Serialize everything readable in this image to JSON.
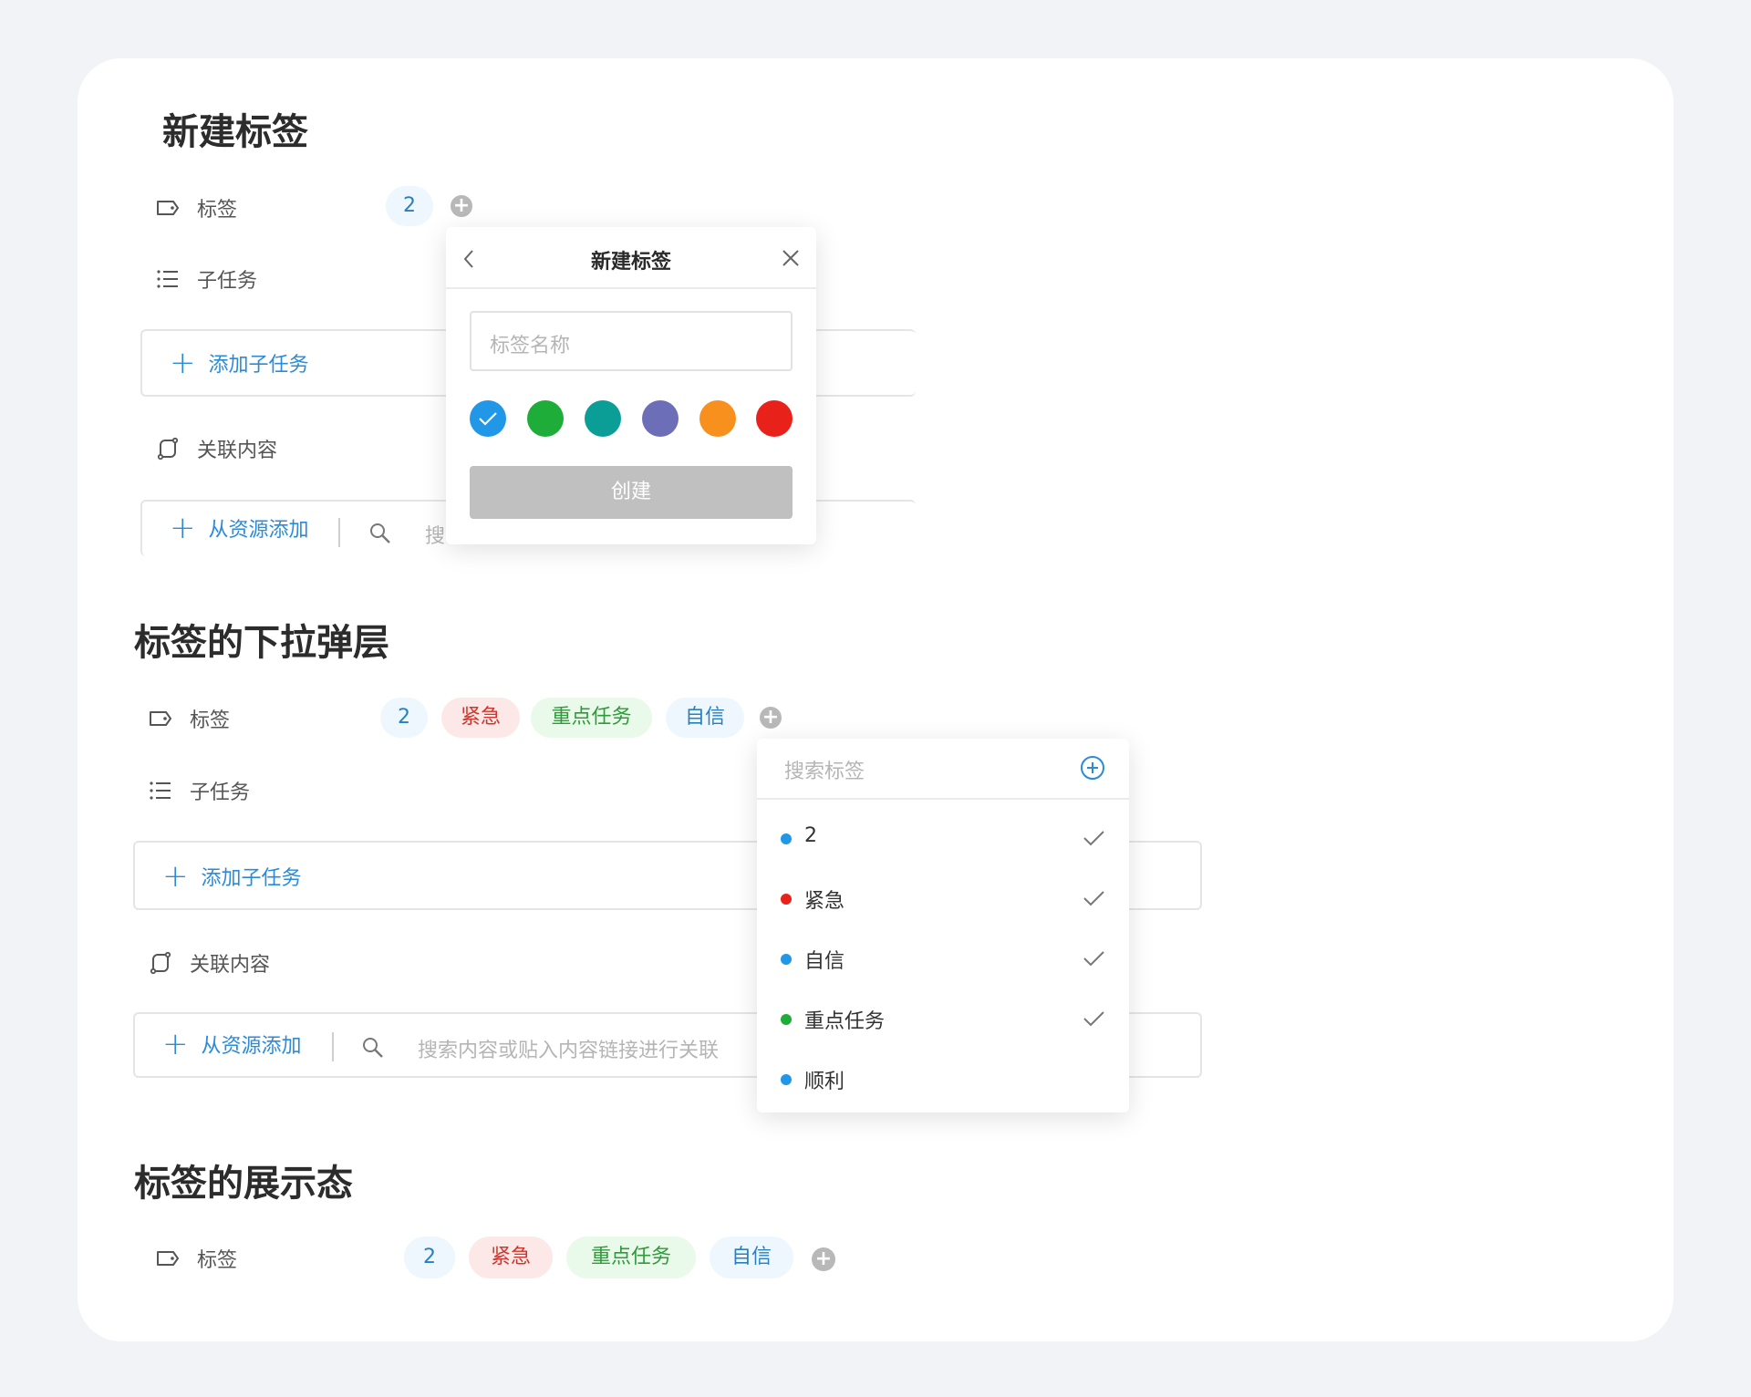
{
  "sections": {
    "create_title": "新建标签",
    "dropdown_title": "标签的下拉弹层",
    "display_title": "标签的展示态"
  },
  "rows": {
    "tag_label": "标签",
    "subtask_label": "子任务",
    "add_subtask": "添加子任务",
    "related_label": "关联内容",
    "add_from_resource": "从资源添加",
    "search_placeholder": "搜索内容或贴入内容链接进行关联",
    "search_truncated": "搜"
  },
  "tags": {
    "count": "2",
    "urgent": "紧急",
    "key_task": "重点任务",
    "confident": "自信"
  },
  "create_popup": {
    "title": "新建标签",
    "name_placeholder": "标签名称",
    "create_button": "创建",
    "colors": [
      "#2197e8",
      "#1fad39",
      "#0a9e96",
      "#6c6fb8",
      "#f8901d",
      "#e8221a"
    ]
  },
  "dropdown": {
    "search_placeholder": "搜索标签",
    "options": [
      {
        "label": "2",
        "color": "#2197e8",
        "checked": true
      },
      {
        "label": "紧急",
        "color": "#e8221a",
        "checked": true
      },
      {
        "label": "自信",
        "color": "#2197e8",
        "checked": true
      },
      {
        "label": "重点任务",
        "color": "#1fad39",
        "checked": true
      },
      {
        "label": "顺利",
        "color": "#2197e8",
        "checked": false
      }
    ]
  }
}
